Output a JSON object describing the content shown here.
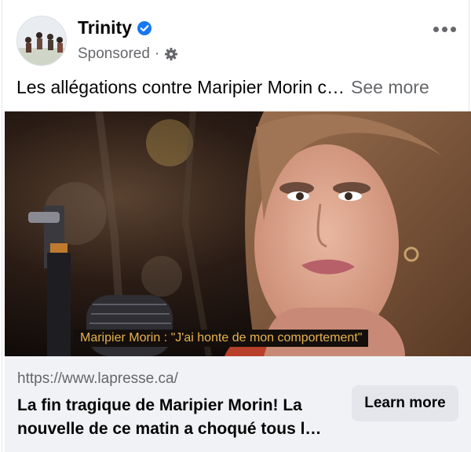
{
  "post": {
    "page_name": "Trinity",
    "verified_icon": "verified-badge-icon",
    "sponsored_label": "Sponsored",
    "separator": "·",
    "audience_icon": "gear-icon",
    "more_icon": "more-options-icon",
    "text": "Les allégations contre Maripier Morin c…",
    "see_more_label": "See more"
  },
  "media": {
    "caption": "Maripier Morin : \"J'ai honte de mon comportement\""
  },
  "link": {
    "url": "https://www.lapresse.ca/",
    "title": "La fin tragique de Maripier Morin! La nouvelle de ce matin a choqué tous l…",
    "cta_label": "Learn more"
  },
  "colors": {
    "verified_blue": "#1877f2",
    "secondary_text": "#65676b",
    "link_card_bg": "#f0f2f5",
    "caption_text": "#e7b34d"
  }
}
